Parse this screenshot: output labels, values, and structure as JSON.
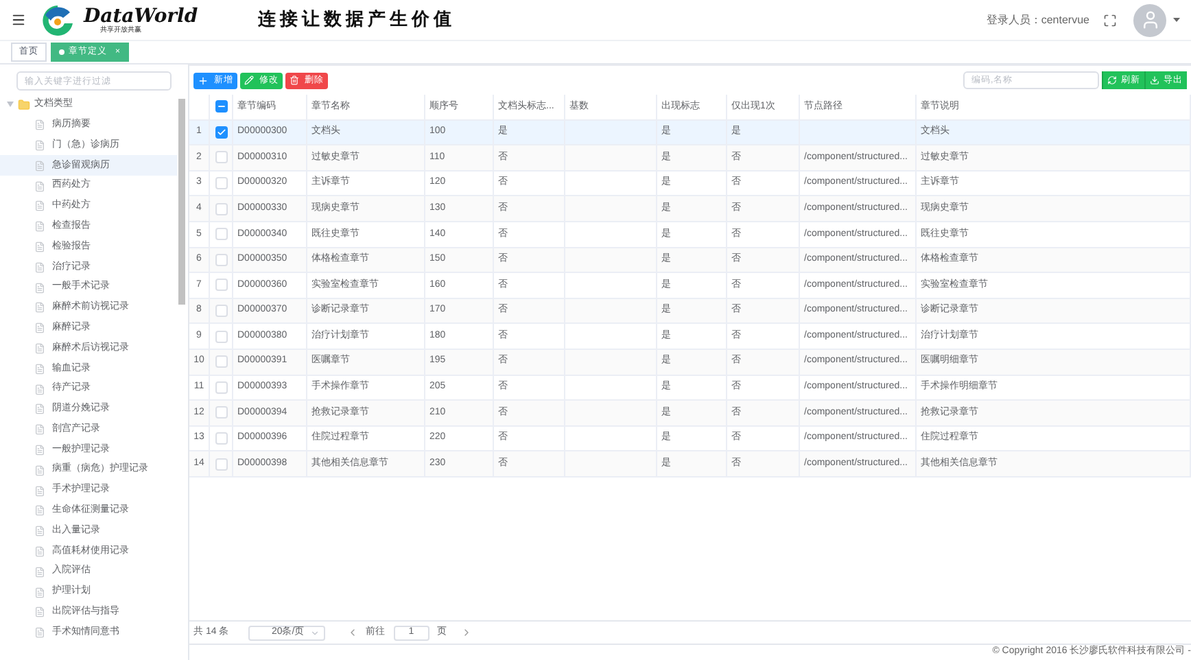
{
  "header": {
    "logo_text": "DataWorld",
    "logo_subtitle": "共享开放共赢",
    "slogan": "连接让数据产生价值",
    "user_label": "登录人员：centervue"
  },
  "tabs": [
    {
      "label": "首页",
      "selected": false
    },
    {
      "label": "章节定义",
      "selected": true,
      "close": "×"
    }
  ],
  "sidebar": {
    "filter_placeholder": "输入关键字进行过滤",
    "tree": [
      {
        "label": "文档类型",
        "expanded": true,
        "children": [
          {
            "label": "病历摘要",
            "selected": false
          },
          {
            "label": "门（急）诊病历",
            "selected": false
          },
          {
            "label": "急诊留观病历",
            "selected": true
          },
          {
            "label": "西药处方",
            "selected": false
          },
          {
            "label": "中药处方",
            "selected": false
          },
          {
            "label": "检查报告",
            "selected": false
          },
          {
            "label": "检验报告",
            "selected": false
          },
          {
            "label": "治疗记录",
            "selected": false
          },
          {
            "label": "一般手术记录",
            "selected": false
          },
          {
            "label": "麻醉术前访视记录",
            "selected": false
          },
          {
            "label": "麻醉记录",
            "selected": false
          },
          {
            "label": "麻醉术后访视记录",
            "selected": false
          },
          {
            "label": "输血记录",
            "selected": false
          },
          {
            "label": "待产记录",
            "selected": false
          },
          {
            "label": "阴道分娩记录",
            "selected": false
          },
          {
            "label": "剖宫产记录",
            "selected": false
          },
          {
            "label": "一般护理记录",
            "selected": false
          },
          {
            "label": "病重（病危）护理记录",
            "selected": false
          },
          {
            "label": "手术护理记录",
            "selected": false
          },
          {
            "label": "生命体征测量记录",
            "selected": false
          },
          {
            "label": "出入量记录",
            "selected": false
          },
          {
            "label": "高值耗材使用记录",
            "selected": false
          },
          {
            "label": "入院评估",
            "selected": false
          },
          {
            "label": "护理计划",
            "selected": false
          },
          {
            "label": "出院评估与指导",
            "selected": false
          },
          {
            "label": "手术知情同意书",
            "selected": false
          }
        ]
      }
    ]
  },
  "toolbar": {
    "buttons": [
      {
        "label": "新增",
        "kind": "add"
      },
      {
        "label": "修改",
        "kind": "edit"
      },
      {
        "label": "删除",
        "kind": "delete"
      }
    ],
    "search_placeholder": "编码,名称",
    "right_buttons": [
      {
        "label": "刷新",
        "kind": "refresh"
      },
      {
        "label": "导出",
        "kind": "export"
      }
    ]
  },
  "table": {
    "columns": [
      "章节编码",
      "章节名称",
      "顺序号",
      "文档头标志...",
      "基数",
      "出现标志",
      "仅出现1次",
      "节点路径",
      "章节说明"
    ],
    "header_indeterminate": true,
    "rows": [
      {
        "index": "1",
        "checked": true,
        "selected": true,
        "cells": [
          "D00000300",
          "文档头",
          "100",
          "是",
          "",
          "是",
          "是",
          "",
          "文档头"
        ]
      },
      {
        "index": "2",
        "checked": false,
        "selected": false,
        "cells": [
          "D00000310",
          "过敏史章节",
          "110",
          "否",
          "",
          "是",
          "否",
          "/component/structured...",
          "过敏史章节"
        ]
      },
      {
        "index": "3",
        "checked": false,
        "selected": false,
        "cells": [
          "D00000320",
          "主诉章节",
          "120",
          "否",
          "",
          "是",
          "否",
          "/component/structured...",
          "主诉章节"
        ]
      },
      {
        "index": "4",
        "checked": false,
        "selected": false,
        "cells": [
          "D00000330",
          "现病史章节",
          "130",
          "否",
          "",
          "是",
          "否",
          "/component/structured...",
          "现病史章节"
        ]
      },
      {
        "index": "5",
        "checked": false,
        "selected": false,
        "cells": [
          "D00000340",
          "既往史章节",
          "140",
          "否",
          "",
          "是",
          "否",
          "/component/structured...",
          "既往史章节"
        ]
      },
      {
        "index": "6",
        "checked": false,
        "selected": false,
        "cells": [
          "D00000350",
          "体格检查章节",
          "150",
          "否",
          "",
          "是",
          "否",
          "/component/structured...",
          "体格检查章节"
        ]
      },
      {
        "index": "7",
        "checked": false,
        "selected": false,
        "cells": [
          "D00000360",
          "实验室检查章节",
          "160",
          "否",
          "",
          "是",
          "否",
          "/component/structured...",
          "实验室检查章节"
        ]
      },
      {
        "index": "8",
        "checked": false,
        "selected": false,
        "cells": [
          "D00000370",
          "诊断记录章节",
          "170",
          "否",
          "",
          "是",
          "否",
          "/component/structured...",
          "诊断记录章节"
        ]
      },
      {
        "index": "9",
        "checked": false,
        "selected": false,
        "cells": [
          "D00000380",
          "治疗计划章节",
          "180",
          "否",
          "",
          "是",
          "否",
          "/component/structured...",
          "治疗计划章节"
        ]
      },
      {
        "index": "10",
        "checked": false,
        "selected": false,
        "cells": [
          "D00000391",
          "医嘱章节",
          "195",
          "否",
          "",
          "是",
          "否",
          "/component/structured...",
          "医嘱明细章节"
        ]
      },
      {
        "index": "11",
        "checked": false,
        "selected": false,
        "cells": [
          "D00000393",
          "手术操作章节",
          "205",
          "否",
          "",
          "是",
          "否",
          "/component/structured...",
          "手术操作明细章节"
        ]
      },
      {
        "index": "12",
        "checked": false,
        "selected": false,
        "cells": [
          "D00000394",
          "抢救记录章节",
          "210",
          "否",
          "",
          "是",
          "否",
          "/component/structured...",
          "抢救记录章节"
        ]
      },
      {
        "index": "13",
        "checked": false,
        "selected": false,
        "cells": [
          "D00000396",
          "住院过程章节",
          "220",
          "否",
          "",
          "是",
          "否",
          "/component/structured...",
          "住院过程章节"
        ]
      },
      {
        "index": "14",
        "checked": false,
        "selected": false,
        "cells": [
          "D00000398",
          "其他相关信息章节",
          "230",
          "否",
          "",
          "是",
          "否",
          "/component/structured...",
          "其他相关信息章节"
        ]
      }
    ]
  },
  "pagination": {
    "total": "共 14 条",
    "page_size": "20条/页",
    "goto_label": "前往",
    "page": "1",
    "page_suffix": "页"
  },
  "footer": "© Copyright 2016 长沙廖氏软件科技有限公司 -"
}
